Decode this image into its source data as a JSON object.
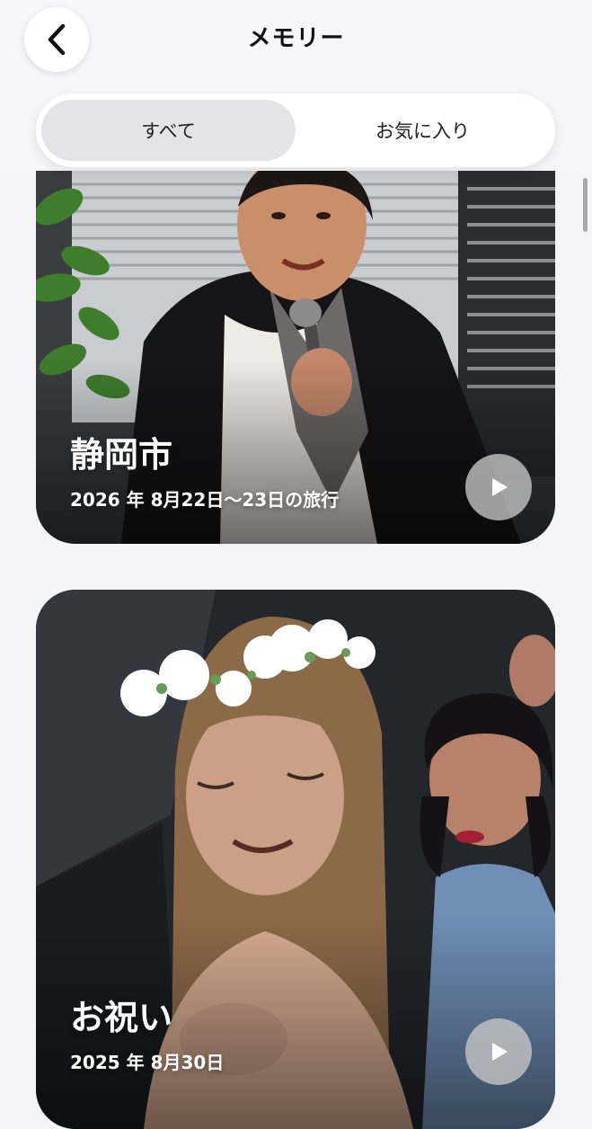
{
  "nav": {
    "title": "メモリー",
    "back_icon": "chevron-left-icon"
  },
  "tabs": [
    {
      "label": "すべて",
      "selected": true
    },
    {
      "label": "お気に入り",
      "selected": false
    }
  ],
  "memories": [
    {
      "title": "静岡市",
      "subtitle": "2026 年 8月22日～23日の旅行",
      "play_icon": "play-icon"
    },
    {
      "title": "お祝い",
      "subtitle": "2025 年 8月30日",
      "play_icon": "play-icon"
    }
  ],
  "colors": {
    "accent_text": "#111111",
    "segment_active": "#e4e4e6"
  }
}
